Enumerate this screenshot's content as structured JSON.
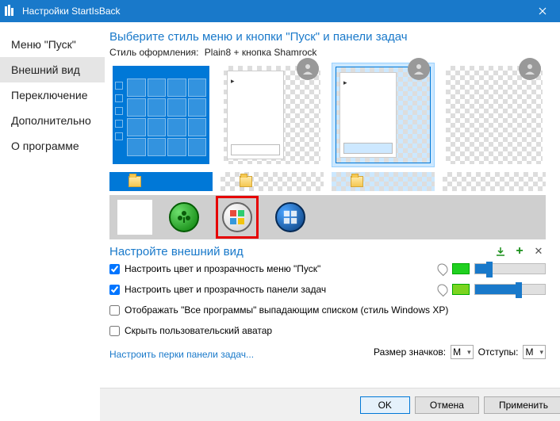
{
  "titlebar": {
    "title": "Настройки StartIsBack"
  },
  "sidebar": {
    "items": [
      {
        "label": "Меню \"Пуск\""
      },
      {
        "label": "Внешний вид"
      },
      {
        "label": "Переключение"
      },
      {
        "label": "Дополнительно"
      },
      {
        "label": "О программе"
      }
    ]
  },
  "heading": "Выберите стиль меню и кнопки \"Пуск\" и панели задач",
  "style_label": "Стиль оформления:",
  "style_value": "Plain8 + кнопка Shamrock",
  "appearance_heading": "Настройте внешний вид",
  "options": {
    "menu_color": "Настроить цвет и прозрачность меню \"Пуск\"",
    "taskbar_color": "Настроить цвет и прозрачность панели задач",
    "all_programs": "Отображать \"Все программы\" выпадающим списком (стиль Windows XP)",
    "hide_avatar": "Скрыть пользовательский аватар"
  },
  "link": "Настроить перки панели задач...",
  "bottom": {
    "icon_size_label": "Размер значков:",
    "icon_size_value": "M",
    "margins_label": "Отступы:",
    "margins_value": "M"
  },
  "sliders": {
    "menu": {
      "fill_pct": 18,
      "thumb_pct": 16,
      "swatch": "#20d020"
    },
    "taskbar": {
      "fill_pct": 60,
      "thumb_pct": 58,
      "swatch": "#7cd420"
    }
  },
  "checkboxes": {
    "menu_color": true,
    "taskbar_color": true,
    "all_programs": false,
    "hide_avatar": false
  },
  "footer": {
    "ok": "OK",
    "cancel": "Отмена",
    "apply": "Применить"
  }
}
